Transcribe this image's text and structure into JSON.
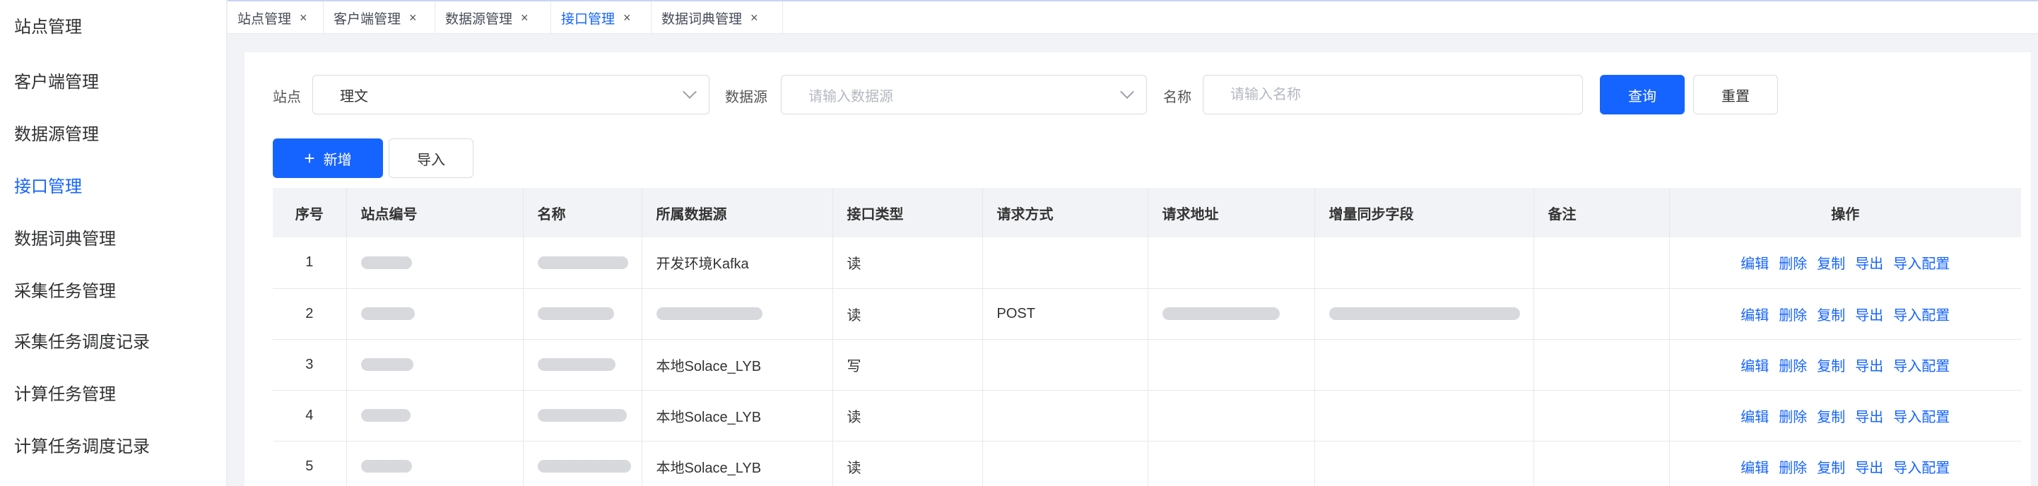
{
  "sidebar": {
    "items": [
      {
        "label": "站点管理"
      },
      {
        "label": "客户端管理"
      },
      {
        "label": "数据源管理"
      },
      {
        "label": "接口管理"
      },
      {
        "label": "数据词典管理"
      },
      {
        "label": "采集任务管理"
      },
      {
        "label": "采集任务调度记录"
      },
      {
        "label": "计算任务管理"
      },
      {
        "label": "计算任务调度记录"
      }
    ]
  },
  "tabs": [
    {
      "label": "站点管理",
      "close": "×"
    },
    {
      "label": "客户端管理",
      "close": "×"
    },
    {
      "label": "数据源管理",
      "close": "×"
    },
    {
      "label": "接口管理",
      "close": "×"
    },
    {
      "label": "数据词典管理",
      "close": "×"
    }
  ],
  "filters": {
    "site_label": "站点",
    "site_value": "理文",
    "datasource_label": "数据源",
    "datasource_placeholder": "请输入数据源",
    "name_label": "名称",
    "name_placeholder": "请输入名称",
    "query_label": "查询",
    "reset_label": "重置"
  },
  "actions": {
    "add_icon": "+",
    "add_label": "新增",
    "import_label": "导入"
  },
  "table": {
    "headers": [
      "序号",
      "站点编号",
      "名称",
      "所属数据源",
      "接口类型",
      "请求方式",
      "请求地址",
      "增量同步字段",
      "备注",
      "操作"
    ],
    "rows": [
      {
        "idx": "1",
        "datasource": "开发环境Kafka",
        "type": "读",
        "method": ""
      },
      {
        "idx": "2",
        "datasource": "",
        "type": "读",
        "method": "POST"
      },
      {
        "idx": "3",
        "datasource": "本地Solace_LYB",
        "type": "写",
        "method": ""
      },
      {
        "idx": "4",
        "datasource": "本地Solace_LYB",
        "type": "读",
        "method": ""
      },
      {
        "idx": "5",
        "datasource": "本地Solace_LYB",
        "type": "读",
        "method": ""
      }
    ],
    "ops": [
      "编辑",
      "删除",
      "复制",
      "导出",
      "导入配置"
    ]
  },
  "colors": {
    "accent": "#1664ff",
    "header_bg": "#f2f3f6",
    "page_bg": "#f2f3f6"
  }
}
